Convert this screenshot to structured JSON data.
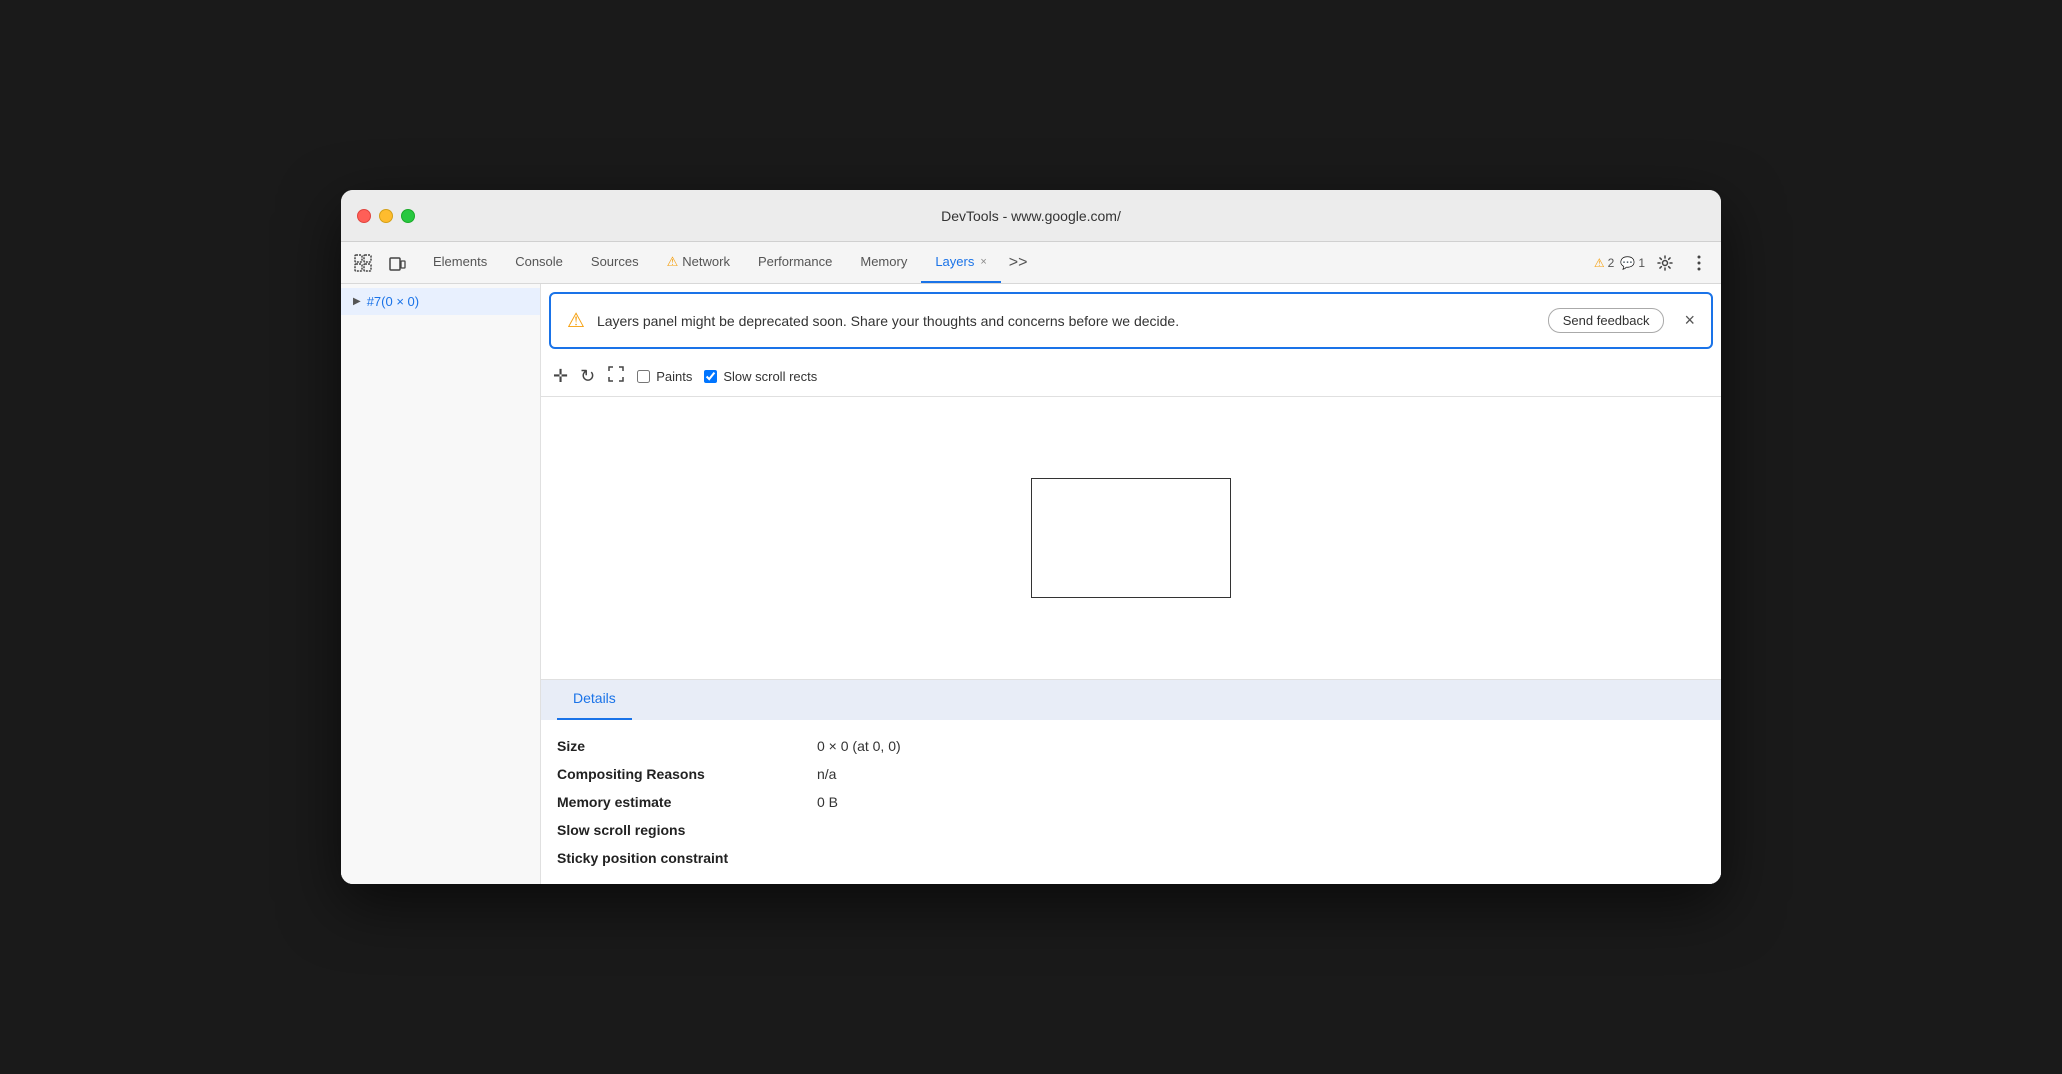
{
  "window": {
    "title": "DevTools - www.google.com/"
  },
  "traffic_lights": {
    "close": "close",
    "minimize": "minimize",
    "maximize": "maximize"
  },
  "tabs": [
    {
      "id": "elements",
      "label": "Elements",
      "active": false,
      "closable": false,
      "warn": false
    },
    {
      "id": "console",
      "label": "Console",
      "active": false,
      "closable": false,
      "warn": false
    },
    {
      "id": "sources",
      "label": "Sources",
      "active": false,
      "closable": false,
      "warn": false
    },
    {
      "id": "network",
      "label": "Network",
      "active": false,
      "closable": false,
      "warn": true
    },
    {
      "id": "performance",
      "label": "Performance",
      "active": false,
      "closable": false,
      "warn": false
    },
    {
      "id": "memory",
      "label": "Memory",
      "active": false,
      "closable": false,
      "warn": false
    },
    {
      "id": "layers",
      "label": "Layers",
      "active": true,
      "closable": true,
      "warn": false
    }
  ],
  "more_tabs_label": ">>",
  "badges": {
    "warning_count": "2",
    "info_count": "1"
  },
  "sidebar": {
    "items": [
      {
        "id": "layer1",
        "label": "#7(0 × 0)",
        "selected": true
      }
    ]
  },
  "banner": {
    "message": "Layers panel might be deprecated soon. Share your thoughts and concerns before we decide.",
    "send_feedback_label": "Send feedback",
    "close_label": "×"
  },
  "toolbar": {
    "paints_label": "Paints",
    "slow_scroll_label": "Slow scroll rects"
  },
  "details": {
    "header": "Details",
    "rows": [
      {
        "label": "Size",
        "value": "0 × 0 (at 0, 0)"
      },
      {
        "label": "Compositing Reasons",
        "value": "n/a"
      },
      {
        "label": "Memory estimate",
        "value": "0 B"
      },
      {
        "label": "Slow scroll regions",
        "value": ""
      },
      {
        "label": "Sticky position constraint",
        "value": ""
      }
    ]
  }
}
